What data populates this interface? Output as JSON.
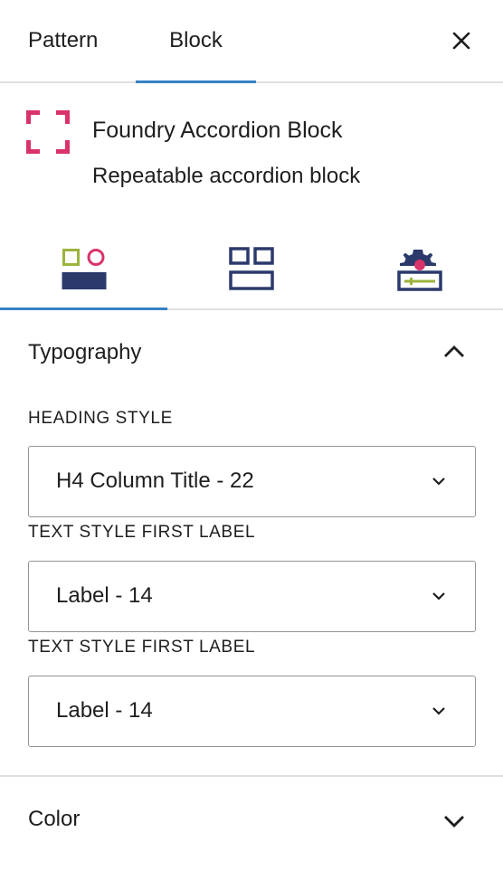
{
  "header": {
    "tabs": [
      {
        "label": "Pattern",
        "active": false
      },
      {
        "label": "Block",
        "active": true
      }
    ],
    "close_icon": "close-icon"
  },
  "block": {
    "title": "Foundry Accordion Block",
    "description": "Repeatable accordion block",
    "icon": "block-placeholder-icon",
    "icon_color": "#d9336c"
  },
  "icon_tabs": [
    {
      "icon": "styles-icon",
      "active": true
    },
    {
      "icon": "layout-grid-icon",
      "active": false
    },
    {
      "icon": "advanced-settings-icon",
      "active": false
    }
  ],
  "typography": {
    "title": "Typography",
    "expanded": true,
    "fields": [
      {
        "label": "HEADING STYLE",
        "value": "H4 Column Title - 22"
      },
      {
        "label": "TEXT STYLE FIRST LABEL",
        "value": "Label - 14"
      },
      {
        "label": "TEXT STYLE FIRST LABEL",
        "value": "Label - 14"
      }
    ]
  },
  "color_panel": {
    "title": "Color",
    "expanded": false
  },
  "colors": {
    "accent": "#3582c4",
    "navy": "#2b3a6b",
    "pink": "#d9336c",
    "olive": "#9bb43c"
  }
}
